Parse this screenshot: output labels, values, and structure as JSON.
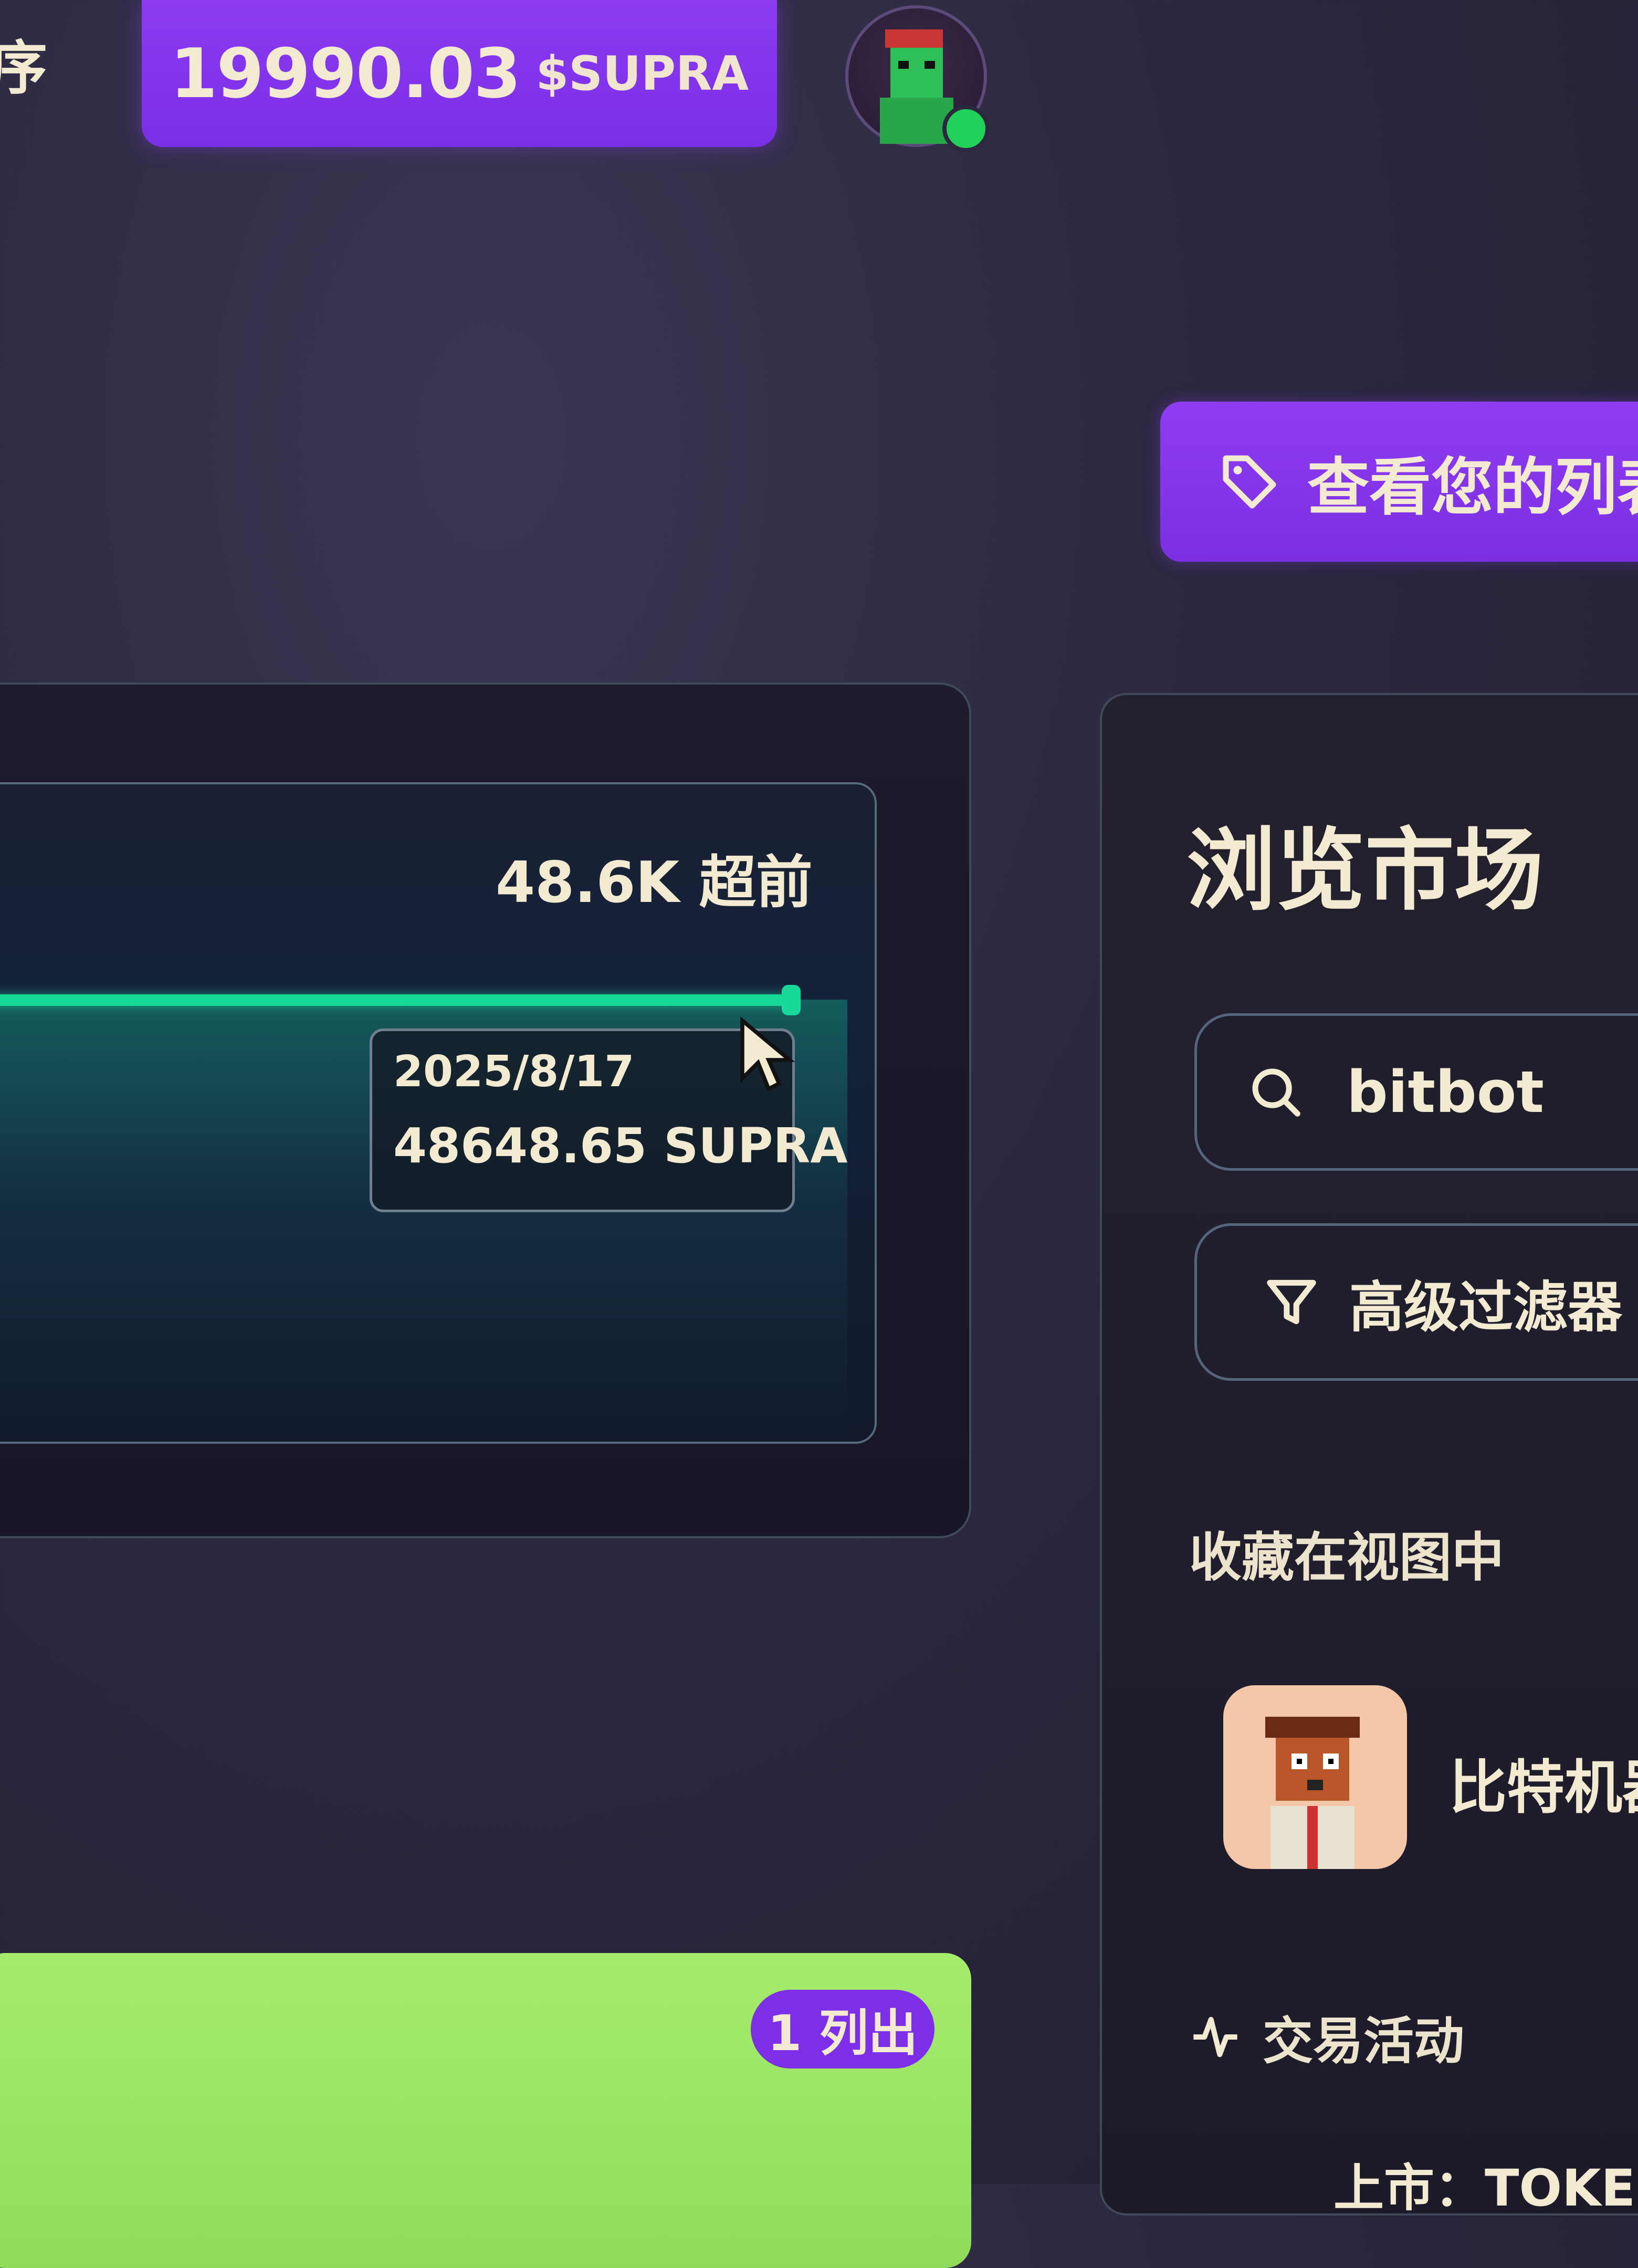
{
  "header": {
    "edge_text": "序",
    "balance_amount": "19990.03",
    "balance_unit": "$SUPRA",
    "avatar_status": "online"
  },
  "actions": {
    "view_listings_label": "查看您的列表"
  },
  "chart": {
    "max_label": "48.6K 超前",
    "tooltip_date": "2025/8/17",
    "tooltip_value": "48648.65 SUPRA",
    "line_color": "#19d99a"
  },
  "market": {
    "title": "浏览市场",
    "search_value": "bitbot",
    "filter_label": "高级过滤器",
    "favorites_label": "收藏在视图中",
    "collection_name": "比特机器",
    "activity_label": "交易活动",
    "listing_line": "上市：TOKEN"
  },
  "card": {
    "listed_badge": "1 列出",
    "color": "#a6ec6c"
  },
  "colors": {
    "accent_purple": "#8c3bf0",
    "background": "#2b283f",
    "text": "#f3ead2",
    "online": "#22d15a"
  }
}
